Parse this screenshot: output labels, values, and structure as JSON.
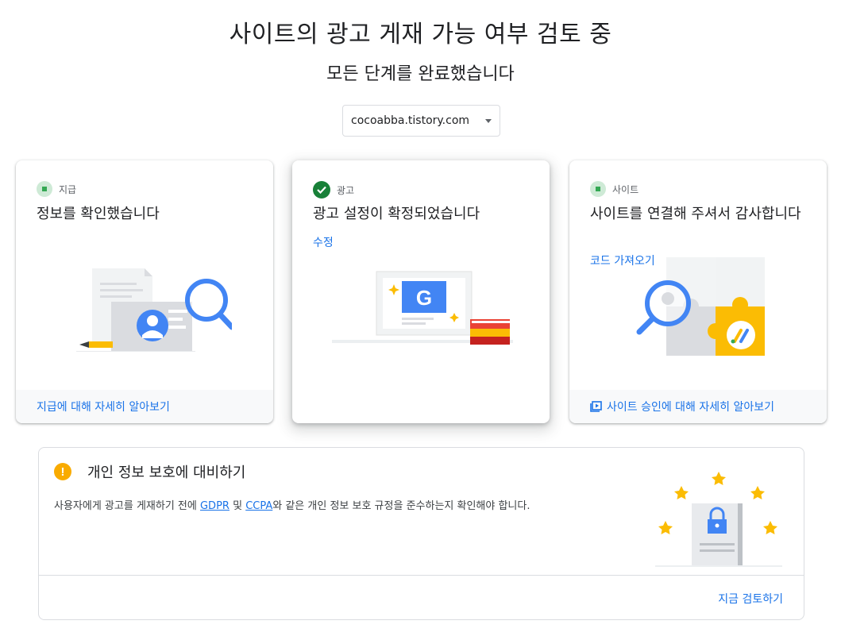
{
  "page": {
    "title": "사이트의 광고 게재 가능 여부 검토 중",
    "subtitle": "모든 단계를 완료했습니다"
  },
  "site_selector": {
    "value": "cocoabba.tistory.com"
  },
  "cards": {
    "payment": {
      "label": "지급",
      "heading": "정보를 확인했습니다",
      "footer_link": "지급에 대해 자세히 알아보기"
    },
    "ads": {
      "label": "광고",
      "heading": "광고 설정이 확정되었습니다",
      "action_link": "수정"
    },
    "site": {
      "label": "사이트",
      "heading": "사이트를 연결해 주셔서 감사합니다",
      "action_link": "코드 가져오기",
      "footer_link": "사이트 승인에 대해 자세히 알아보기"
    }
  },
  "privacy": {
    "title": "개인 정보 보호에 대비하기",
    "desc_before": "사용자에게 광고를 게재하기 전에 ",
    "gdpr_link": "GDPR",
    "desc_mid": " 및 ",
    "ccpa_link": "CCPA",
    "desc_after": "와 같은 개인 정보 보호 규정을 준수하는지 확인해야 합니다.",
    "review_button": "지금 검토하기"
  },
  "colors": {
    "link": "#1a73e8",
    "success": "#188038",
    "status_dot": "#34a853",
    "warning": "#f9ab00",
    "google_blue": "#4285f4",
    "yellow": "#fbbc04"
  }
}
